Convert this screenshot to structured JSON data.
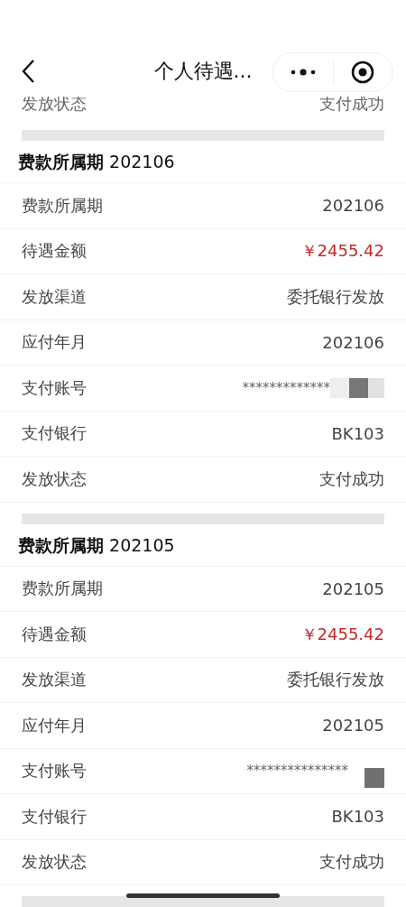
{
  "header": {
    "title": "个人待遇..."
  },
  "partial_row": {
    "label": "发放状态",
    "value": "支付成功"
  },
  "sections": [
    {
      "title": "**费款所属期** 202106",
      "rows": [
        {
          "kind": "text",
          "label": "费款所属期",
          "value": "202106"
        },
        {
          "kind": "amount",
          "label": "待遇金额",
          "value": "￥2455.42"
        },
        {
          "kind": "text",
          "label": "发放渠道",
          "value": "委托银行发放"
        },
        {
          "kind": "text",
          "label": "应付年月",
          "value": "202106"
        },
        {
          "kind": "masked",
          "label": "支付账号",
          "value": "*************"
        },
        {
          "kind": "text",
          "label": "支付银行",
          "value": "BK103"
        },
        {
          "kind": "text",
          "label": "发放状态",
          "value": "支付成功"
        }
      ]
    },
    {
      "title": "**费款所属期** 202105",
      "rows": [
        {
          "kind": "text",
          "label": "费款所属期",
          "value": "202105"
        },
        {
          "kind": "amount",
          "label": "待遇金额",
          "value": "￥2455.42"
        },
        {
          "kind": "text",
          "label": "发放渠道",
          "value": "委托银行发放"
        },
        {
          "kind": "text",
          "label": "应付年月",
          "value": "202105"
        },
        {
          "kind": "masked",
          "label": "支付账号",
          "value": "***************"
        },
        {
          "kind": "text",
          "label": "支付银行",
          "value": "BK103"
        },
        {
          "kind": "text",
          "label": "发放状态",
          "value": "支付成功"
        }
      ]
    }
  ]
}
